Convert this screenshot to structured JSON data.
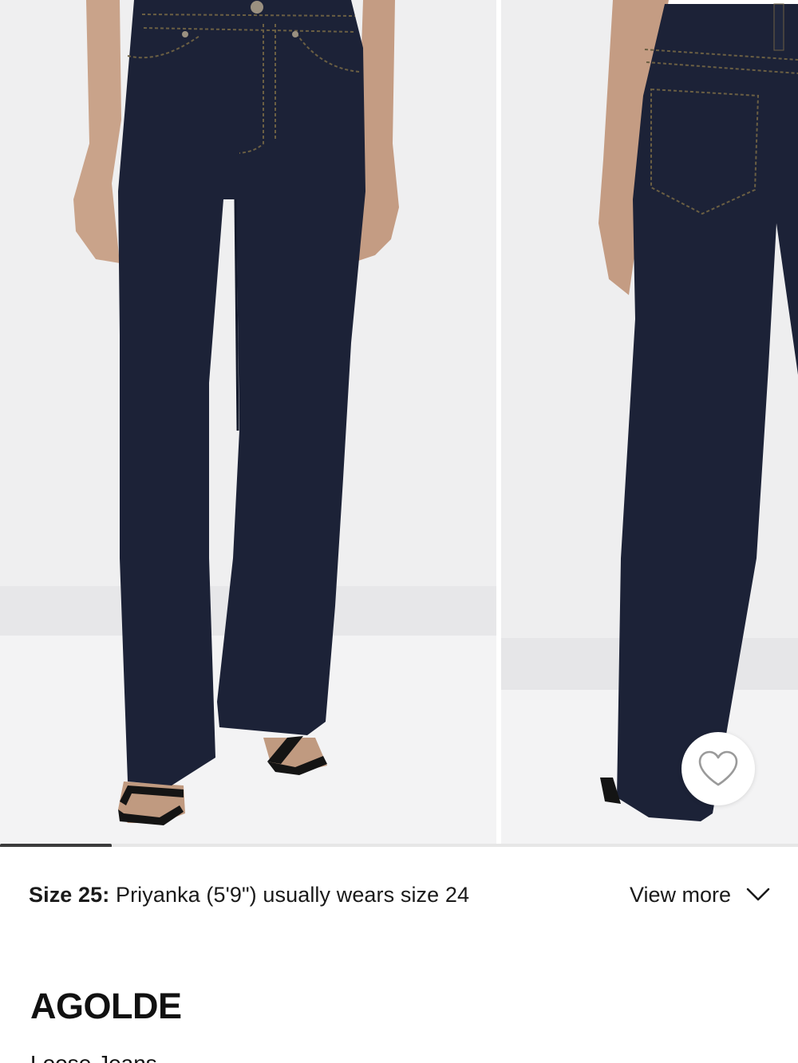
{
  "gallery": {
    "images": [
      {
        "alt": "front view of dark rinse wide leg jeans"
      },
      {
        "alt": "back view of dark rinse wide leg jeans"
      }
    ],
    "progress": 0.14
  },
  "wishlist": {
    "icon": "heart-outline-icon"
  },
  "fit": {
    "size_label": "Size 25:",
    "model_text": "Priyanka (5'9\") usually wears size 24",
    "view_more_label": "View more",
    "view_more_icon": "chevron-down-icon"
  },
  "product": {
    "brand": "AGOLDE",
    "name": "Loose Jeans"
  },
  "colors": {
    "denim": "#1c2237",
    "background": "#eeeeef",
    "progress": "#3c3c3c"
  }
}
